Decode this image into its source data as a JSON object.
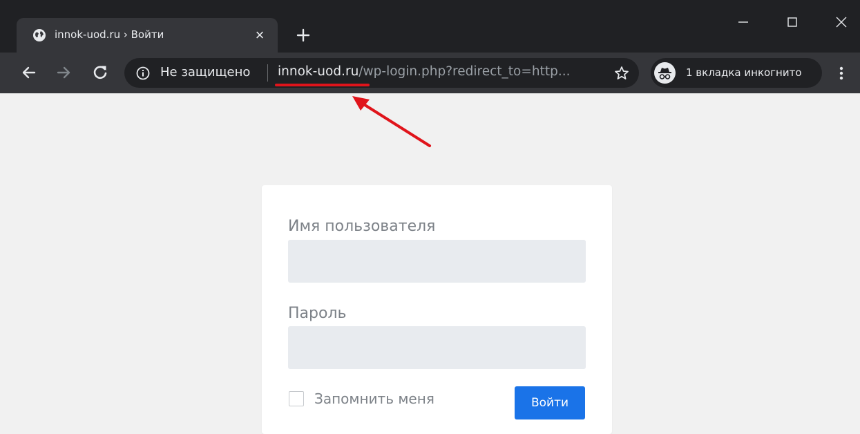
{
  "tab": {
    "title": "innok-uod.ru › Войти",
    "favicon": "globe-icon",
    "close": "×"
  },
  "toolbar": {
    "security_label": "Не защищено",
    "url_domain": "innok-uod.ru",
    "url_path": "/wp-login.php?redirect_to=http...",
    "incognito_label": "1 вкладка инкогнито"
  },
  "login": {
    "username_label": "Имя пользователя",
    "username_value": "",
    "password_label": "Пароль",
    "password_value": "",
    "remember_label": "Запомнить меня",
    "remember_checked": false,
    "submit_label": "Войти"
  },
  "colors": {
    "chrome_dark": "#202124",
    "chrome_toolbar": "#35363a",
    "annotation_red": "#e0141b",
    "button_blue": "#1a73e8",
    "page_bg": "#f1f1f1"
  }
}
